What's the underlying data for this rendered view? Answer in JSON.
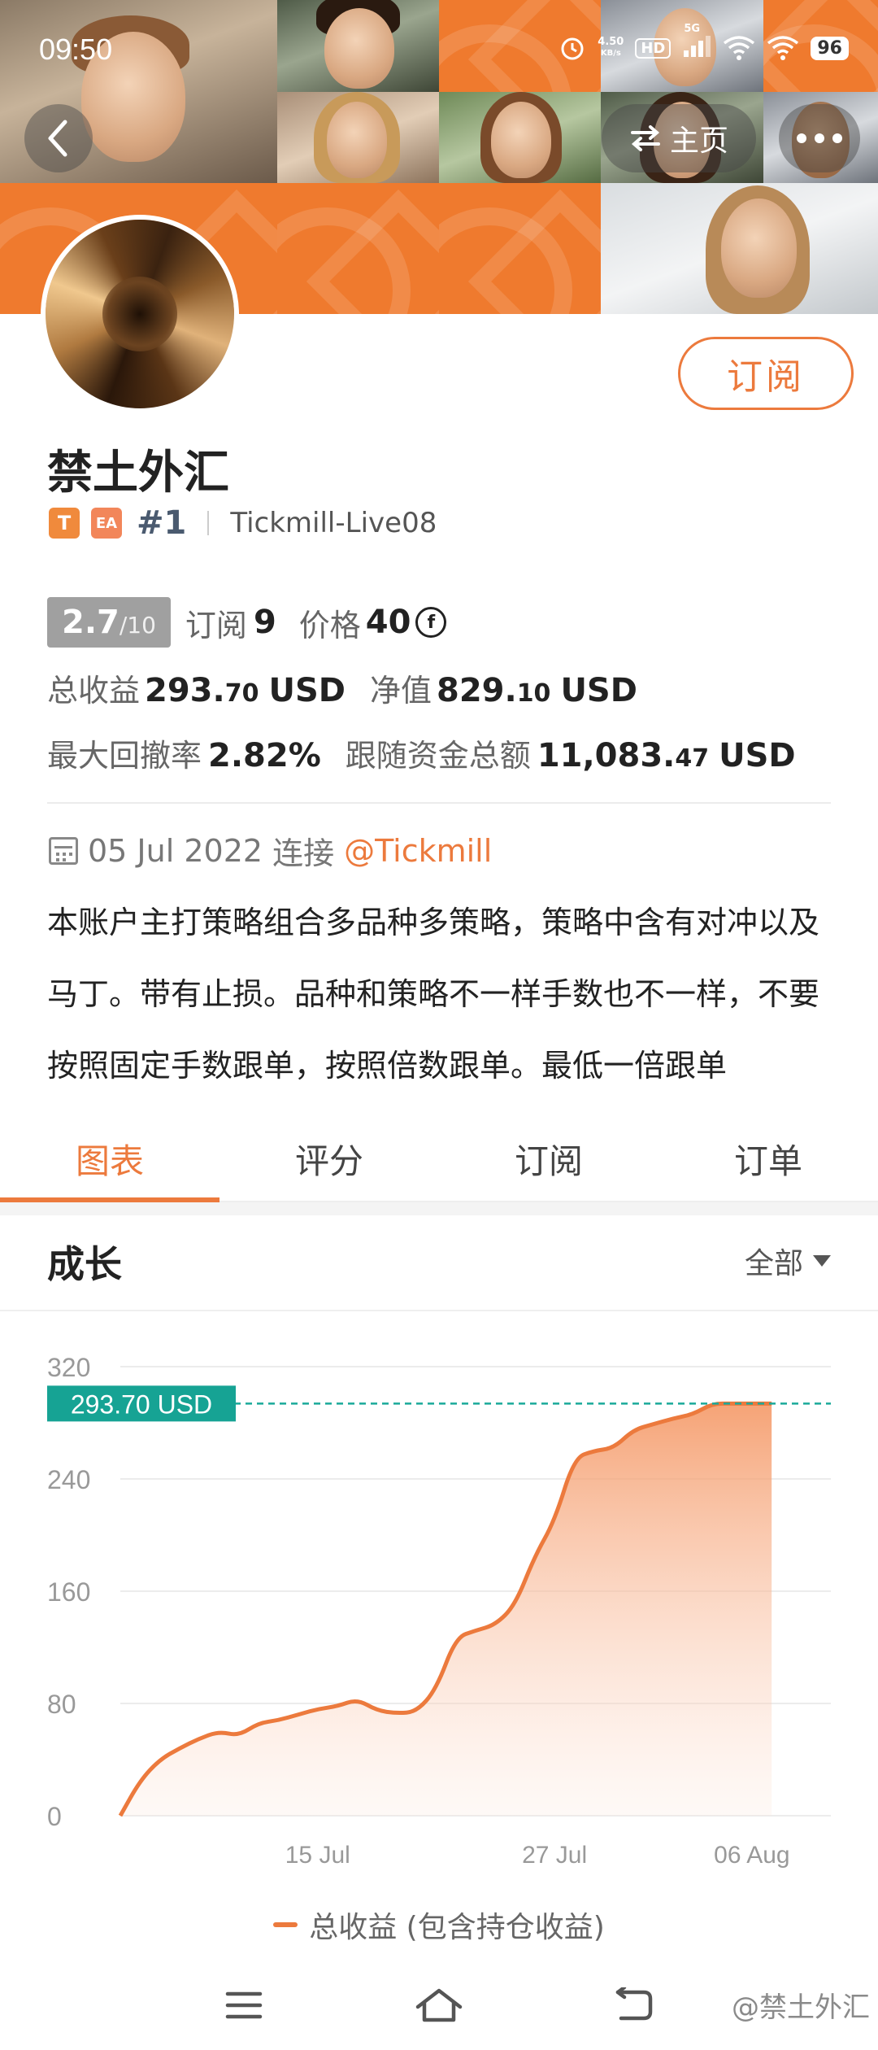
{
  "status_bar": {
    "time": "09:50",
    "net_speed_value": "4.50",
    "net_speed_unit": "KB/s",
    "hd_label": "HD",
    "signal_label": "5G",
    "battery": "96"
  },
  "header": {
    "home_label": "主页",
    "back_icon": "chevron-left-icon",
    "more_icon": "more-dots-icon"
  },
  "profile": {
    "name": "禁土外汇",
    "subscribe_label": "订阅",
    "tag_t": "T",
    "tag_ea": "EA",
    "rank": "#1",
    "server": "Tickmill-Live08"
  },
  "stats": {
    "score": "2.7",
    "score_max": "/10",
    "subscribers_label": "订阅",
    "subscribers": "9",
    "price_label": "价格",
    "price": "40",
    "total_profit_label": "总收益",
    "total_profit_int": "293.",
    "total_profit_dec": "70",
    "total_profit_unit": "USD",
    "equity_label": "净值",
    "equity_int": "829.",
    "equity_dec": "10",
    "equity_unit": "USD",
    "max_drawdown_label": "最大回撤率",
    "max_drawdown": "2.82%",
    "follow_funds_label": "跟随资金总额",
    "follow_funds_int": "11,083.",
    "follow_funds_dec": "47",
    "follow_funds_unit": "USD"
  },
  "info": {
    "date": "05 Jul 2022",
    "connect_label": "连接",
    "broker_mention": "@Tickmill",
    "description": "本账户主打策略组合多品种多策略，策略中含有对冲以及马丁。带有止损。品种和策略不一样手数也不一样，不要按照固定手数跟单，按照倍数跟单。最低一倍跟单"
  },
  "tabs": [
    "图表",
    "评分",
    "订阅",
    "订单"
  ],
  "active_tab": 0,
  "growth": {
    "title": "成长",
    "range": "全部"
  },
  "chart_data": {
    "type": "area",
    "y_ticks": [
      "320",
      "240",
      "160",
      "80",
      "0"
    ],
    "x_ticks": [
      "15 Jul",
      "27 Jul",
      "06 Aug"
    ],
    "ylim": [
      0,
      320
    ],
    "xlim": [
      "05 Jul",
      "10 Aug"
    ],
    "last_value_label": "293.70 USD",
    "last_value": 293.7,
    "series": [
      {
        "name": "总收益 (包含持仓收益)",
        "color": "#ec7a3d",
        "points": [
          [
            "05 Jul",
            0
          ],
          [
            "06 Jul",
            25
          ],
          [
            "07 Jul",
            40
          ],
          [
            "08 Jul",
            48
          ],
          [
            "09 Jul",
            55
          ],
          [
            "10 Jul",
            60
          ],
          [
            "11 Jul",
            57
          ],
          [
            "12 Jul",
            66
          ],
          [
            "13 Jul",
            68
          ],
          [
            "14 Jul",
            72
          ],
          [
            "15 Jul",
            76
          ],
          [
            "16 Jul",
            78
          ],
          [
            "17 Jul",
            83
          ],
          [
            "18 Jul",
            75
          ],
          [
            "19 Jul",
            73
          ],
          [
            "20 Jul",
            74
          ],
          [
            "21 Jul",
            90
          ],
          [
            "22 Jul",
            127
          ],
          [
            "23 Jul",
            132
          ],
          [
            "24 Jul",
            136
          ],
          [
            "25 Jul",
            150
          ],
          [
            "26 Jul",
            185
          ],
          [
            "27 Jul",
            210
          ],
          [
            "28 Jul",
            255
          ],
          [
            "29 Jul",
            260
          ],
          [
            "30 Jul",
            262
          ],
          [
            "31 Jul",
            275
          ],
          [
            "01 Aug",
            279
          ],
          [
            "02 Aug",
            283
          ],
          [
            "03 Aug",
            286
          ],
          [
            "04 Aug",
            293.7
          ],
          [
            "05 Aug",
            293.7
          ],
          [
            "06 Aug",
            293.7
          ],
          [
            "07 Aug",
            293.7
          ]
        ]
      }
    ]
  },
  "legend": {
    "label": "总收益 (包含持仓收益)"
  },
  "watermark": "@禁土外汇"
}
